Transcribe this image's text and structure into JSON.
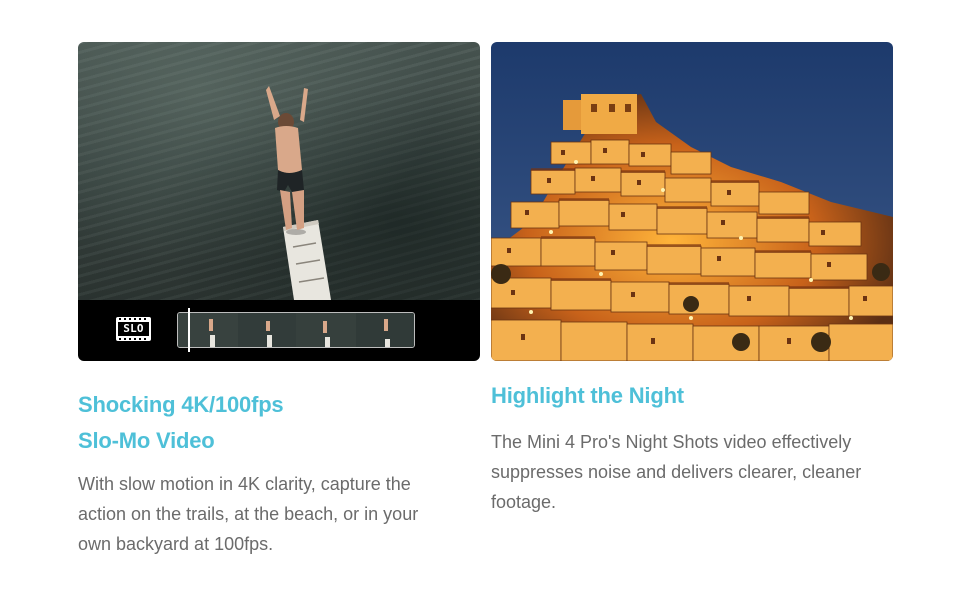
{
  "features": [
    {
      "title_line1": "Shocking 4K/100fps",
      "title_line2": "Slo-Mo Video",
      "description": "With slow motion in 4K clarity, capture the action on the trails, at the beach, or in your own backyard at 100fps.",
      "badge": "SLO"
    },
    {
      "title": "Highlight the Night",
      "description": "The Mini 4 Pro's Night Shots video effectively suppresses noise and delivers clearer, cleaner footage."
    }
  ],
  "colors": {
    "title": "#4ec0d8",
    "text": "#6b6b6b",
    "background": "#ffffff"
  }
}
